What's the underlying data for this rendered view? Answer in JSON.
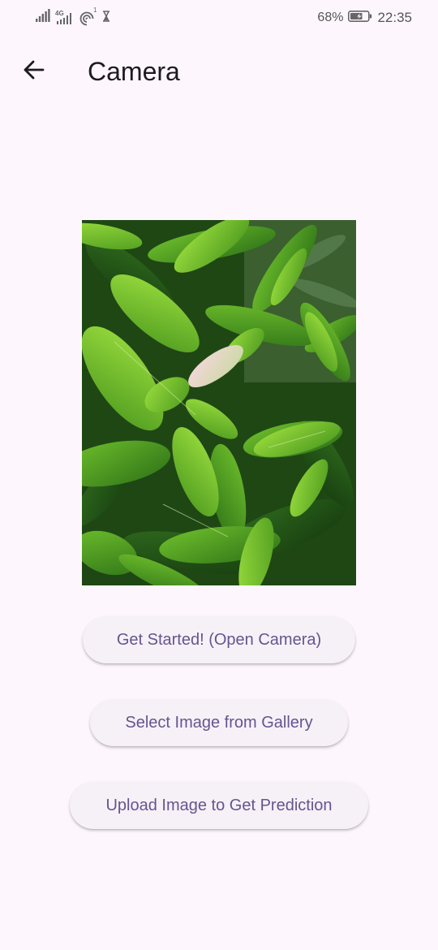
{
  "status_bar": {
    "signal_icons": [
      "signal-bars-icon",
      "signal-4g-icon",
      "hotspot-icon",
      "hourglass-icon"
    ],
    "network_label": "4G",
    "hotspot_count": "1",
    "battery_percent": "68%",
    "time": "22:35"
  },
  "app_bar": {
    "back_icon": "arrow-back-icon",
    "title": "Camera"
  },
  "preview": {
    "image": "tea-leaves-photo"
  },
  "actions": {
    "open_camera_label": "Get Started! (Open Camera)",
    "gallery_label": "Select Image from Gallery",
    "upload_label": "Upload Image to Get Prediction"
  },
  "colors": {
    "background": "#fdf7fd",
    "button_background": "#f6f1f7",
    "button_text": "#65558f",
    "title_text": "#1d1b20"
  }
}
